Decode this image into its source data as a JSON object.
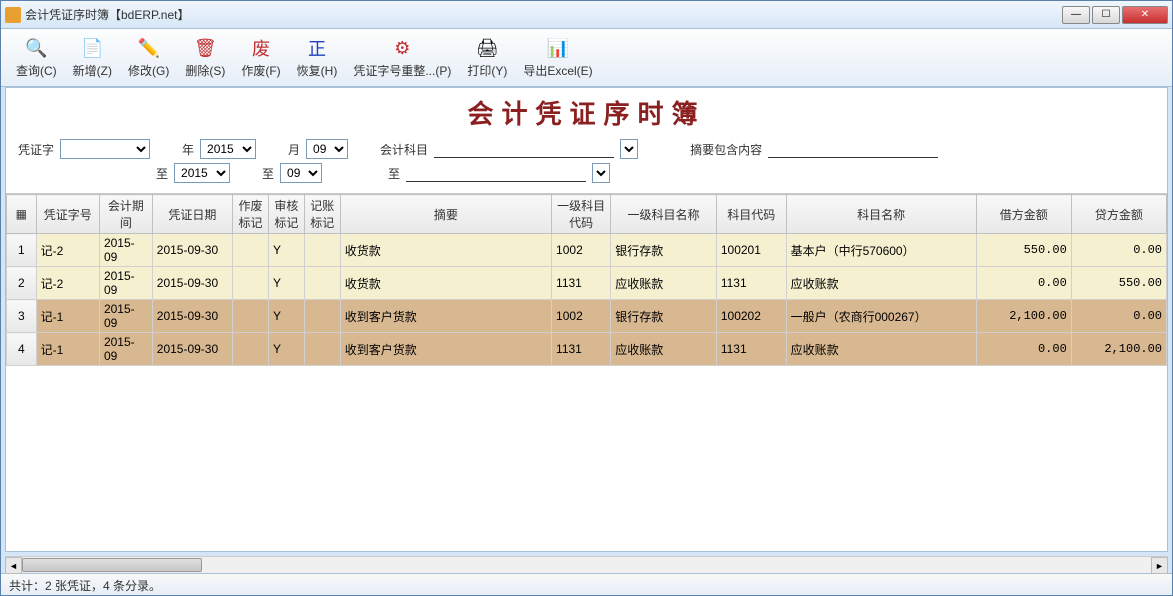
{
  "window": {
    "title": "会计凭证序时簿【bdERP.net】"
  },
  "toolbar": [
    {
      "label": "查询(C)",
      "icon": "🔍",
      "name": "query-button"
    },
    {
      "label": "新增(Z)",
      "icon": "📄",
      "name": "new-button"
    },
    {
      "label": "修改(G)",
      "icon": "✏️",
      "name": "edit-button"
    },
    {
      "label": "删除(S)",
      "icon": "🗑",
      "name": "delete-button",
      "color": "#c03030"
    },
    {
      "label": "作废(F)",
      "icon": "废",
      "name": "void-button",
      "color": "#c03030"
    },
    {
      "label": "恢复(H)",
      "icon": "正",
      "name": "restore-button",
      "color": "#2040c0"
    },
    {
      "label": "凭证字号重整...(P)",
      "icon": "⚙",
      "name": "renumber-button",
      "color": "#c03030"
    },
    {
      "label": "打印(Y)",
      "icon": "🖨",
      "name": "print-button"
    },
    {
      "label": "导出Excel(E)",
      "icon": "📊",
      "name": "export-excel-button",
      "color": "#107c10"
    }
  ],
  "page_title": "会计凭证序时簿",
  "filters": {
    "voucher_word_label": "凭证字",
    "voucher_word_value": "",
    "year_label": "年",
    "year_value": "2015",
    "month_label": "月",
    "month_value": "09",
    "to_label": "至",
    "year_to_value": "2015",
    "month_to_value": "09",
    "subject_label": "会计科目",
    "subject_value": "",
    "subject_to_value": "",
    "summary_label": "摘要包含内容",
    "summary_value": ""
  },
  "grid": {
    "columns": [
      "",
      "凭证字号",
      "会计期间",
      "凭证日期",
      "作废标记",
      "审核标记",
      "记账标记",
      "摘要",
      "一级科目代码",
      "一级科目名称",
      "科目代码",
      "科目名称",
      "借方金额",
      "贷方金额"
    ],
    "rows": [
      {
        "n": "1",
        "cls": "row-yellow",
        "cells": [
          "记-2",
          "2015-09",
          "2015-09-30",
          "",
          "Y",
          "",
          "收货款",
          "1002",
          "银行存款",
          "100201",
          "基本户（中行570600）",
          "550.00",
          "0.00"
        ]
      },
      {
        "n": "2",
        "cls": "row-yellow",
        "cells": [
          "记-2",
          "2015-09",
          "2015-09-30",
          "",
          "Y",
          "",
          "收货款",
          "1131",
          "应收账款",
          "1131",
          "应收账款",
          "0.00",
          "550.00"
        ]
      },
      {
        "n": "3",
        "cls": "row-brown",
        "cells": [
          "记-1",
          "2015-09",
          "2015-09-30",
          "",
          "Y",
          "",
          "收到客户货款",
          "1002",
          "银行存款",
          "100202",
          "一般户（农商行000267）",
          "2,100.00",
          "0.00"
        ]
      },
      {
        "n": "4",
        "cls": "row-brown",
        "cells": [
          "记-1",
          "2015-09",
          "2015-09-30",
          "",
          "Y",
          "",
          "收到客户货款",
          "1131",
          "应收账款",
          "1131",
          "应收账款",
          "0.00",
          "2,100.00"
        ]
      }
    ]
  },
  "status": "共计：2 张凭证，4 条分录。"
}
